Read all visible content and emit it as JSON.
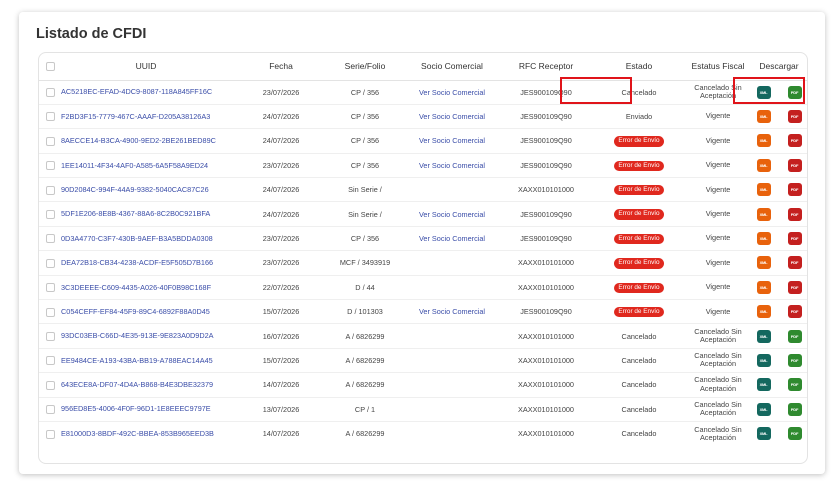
{
  "title": "Listado de CFDI",
  "columns": {
    "uuid": "UUID",
    "fecha": "Fecha",
    "serie": "Serie/Folio",
    "socio": "Socio Comercial",
    "rfc": "RFC Receptor",
    "estado": "Estado",
    "fiscal": "Estatus Fiscal",
    "descargar": "Descargar"
  },
  "download_labels": {
    "xml": "XML",
    "pdf": "PDF"
  },
  "colors": {
    "xml_orange": "#e8620c",
    "pdf_red": "#c4201f",
    "xml_teal": "#14685f",
    "pdf_green": "#2f8a2f",
    "error_badge": "#e0281e",
    "highlight": "#e0141a"
  },
  "rows": [
    {
      "uuid": "AC5218EC-EFAD-4DC9-8087-118A845FF16C",
      "fecha": "23/07/2026",
      "serie": "CP / 356",
      "socio": "Ver Socio Comercial",
      "rfc": "JES900109Q90",
      "estado": "Cancelado",
      "estado_type": "text",
      "fiscal": "Cancelado Sin Aceptación",
      "dl_style": "green"
    },
    {
      "uuid": "F2BD3F15-7779-467C-AAAF-D205A38126A3",
      "fecha": "24/07/2026",
      "serie": "CP / 356",
      "socio": "Ver Socio Comercial",
      "rfc": "JES900109Q90",
      "estado": "Enviado",
      "estado_type": "text",
      "fiscal": "Vigente",
      "dl_style": "red"
    },
    {
      "uuid": "8AECCE14-B3CA-4900-9ED2-2BE261BED89C",
      "fecha": "24/07/2026",
      "serie": "CP / 356",
      "socio": "Ver Socio Comercial",
      "rfc": "JES900109Q90",
      "estado": "Error de Envío",
      "estado_type": "error",
      "fiscal": "Vigente",
      "dl_style": "red"
    },
    {
      "uuid": "1EE14011-4F34-4AF0-A585-6A5F58A9ED24",
      "fecha": "23/07/2026",
      "serie": "CP / 356",
      "socio": "Ver Socio Comercial",
      "rfc": "JES900109Q90",
      "estado": "Error de Envío",
      "estado_type": "error",
      "fiscal": "Vigente",
      "dl_style": "red"
    },
    {
      "uuid": "90D2084C-994F-44A9-9382-5040CAC87C26",
      "fecha": "24/07/2026",
      "serie": "Sin Serie /",
      "socio": "",
      "rfc": "XAXX010101000",
      "estado": "Error de Envío",
      "estado_type": "error",
      "fiscal": "Vigente",
      "dl_style": "red"
    },
    {
      "uuid": "5DF1E206-8E8B-4367-88A6-8C2B0C921BFA",
      "fecha": "24/07/2026",
      "serie": "Sin Serie /",
      "socio": "Ver Socio Comercial",
      "rfc": "JES900109Q90",
      "estado": "Error de Envío",
      "estado_type": "error",
      "fiscal": "Vigente",
      "dl_style": "red"
    },
    {
      "uuid": "0D3A4770-C3F7-430B-9AEF-B3A5BDDA0308",
      "fecha": "23/07/2026",
      "serie": "CP / 356",
      "socio": "Ver Socio Comercial",
      "rfc": "JES900109Q90",
      "estado": "Error de Envío",
      "estado_type": "error",
      "fiscal": "Vigente",
      "dl_style": "red"
    },
    {
      "uuid": "DEA72B18-CB34-4238-ACDF-E5F505D7B166",
      "fecha": "23/07/2026",
      "serie": "MCF / 3493919",
      "socio": "",
      "rfc": "XAXX010101000",
      "estado": "Error de Envío",
      "estado_type": "error",
      "fiscal": "Vigente",
      "dl_style": "red"
    },
    {
      "uuid": "3C3DEEEE-C609-4435-A026-40F0B98C168F",
      "fecha": "22/07/2026",
      "serie": "D / 44",
      "socio": "",
      "rfc": "XAXX010101000",
      "estado": "Error de Envío",
      "estado_type": "error",
      "fiscal": "Vigente",
      "dl_style": "red"
    },
    {
      "uuid": "C054CEFF-EF84-45F9-89C4-6892F88A0D45",
      "fecha": "15/07/2026",
      "serie": "D / 101303",
      "socio": "Ver Socio Comercial",
      "rfc": "JES900109Q90",
      "estado": "Error de Envío",
      "estado_type": "error",
      "fiscal": "Vigente",
      "dl_style": "red"
    },
    {
      "uuid": "93DC03EB-C66D-4E35-913E-9E823A0D9D2A",
      "fecha": "16/07/2026",
      "serie": "A / 6826299",
      "socio": "",
      "rfc": "XAXX010101000",
      "estado": "Cancelado",
      "estado_type": "text",
      "fiscal": "Cancelado Sin Aceptación",
      "dl_style": "green"
    },
    {
      "uuid": "EE9484CE-A193-43BA-BB19-A788EAC14A45",
      "fecha": "15/07/2026",
      "serie": "A / 6826299",
      "socio": "",
      "rfc": "XAXX010101000",
      "estado": "Cancelado",
      "estado_type": "text",
      "fiscal": "Cancelado Sin Aceptación",
      "dl_style": "green"
    },
    {
      "uuid": "643ECE8A-DF07-4D4A-B868-B4E3DBE32379",
      "fecha": "14/07/2026",
      "serie": "A / 6826299",
      "socio": "",
      "rfc": "XAXX010101000",
      "estado": "Cancelado",
      "estado_type": "text",
      "fiscal": "Cancelado Sin Aceptación",
      "dl_style": "green"
    },
    {
      "uuid": "956ED8E5-4006-4F0F-96D1-1E8EEEC9797E",
      "fecha": "13/07/2026",
      "serie": "CP / 1",
      "socio": "",
      "rfc": "XAXX010101000",
      "estado": "Cancelado",
      "estado_type": "text",
      "fiscal": "Cancelado Sin Aceptación",
      "dl_style": "green"
    },
    {
      "uuid": "E81000D3-8BDF-492C-BBEA-853B965EED3B",
      "fecha": "14/07/2026",
      "serie": "A / 6826299",
      "socio": "",
      "rfc": "XAXX010101000",
      "estado": "Cancelado",
      "estado_type": "text",
      "fiscal": "Cancelado Sin Aceptación",
      "dl_style": "green"
    }
  ]
}
